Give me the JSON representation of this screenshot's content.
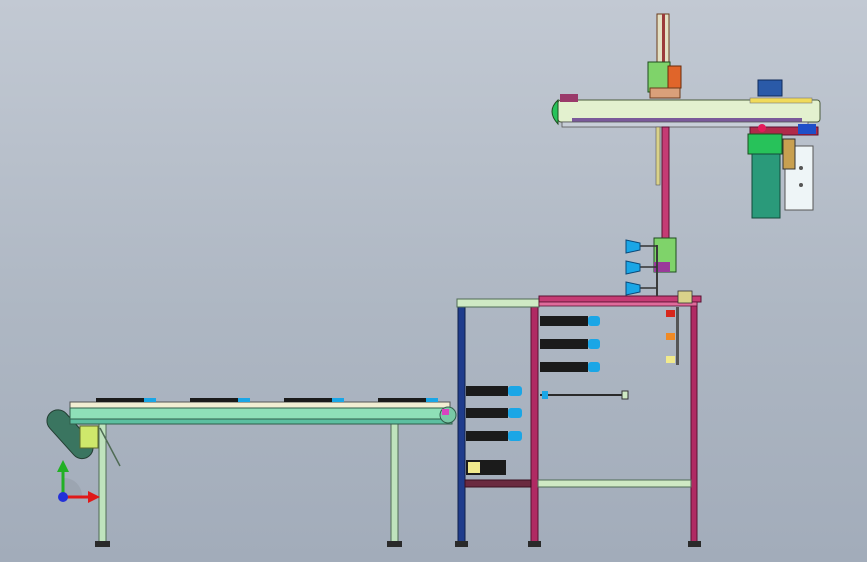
{
  "colors": {
    "background_top": "#c2c9d3",
    "background_bottom": "#a2acba",
    "frame_navy": "#1f3c8c",
    "frame_magenta": "#b02a63",
    "frame_pale_green": "#cfe9c4",
    "gantry_beam": "#e3f1cf",
    "conveyor_belt": "#8fe0b8",
    "gripper_body": "#2a9a7a",
    "nozzle_blue": "#1aa6e6",
    "tray_black": "#1b1b1b",
    "motor_orange": "#e0652a",
    "axis_x": "#e01919",
    "axis_y": "#21b024",
    "axis_z": "#2330d8"
  },
  "icons": [
    "coordinate-triad-icon"
  ]
}
